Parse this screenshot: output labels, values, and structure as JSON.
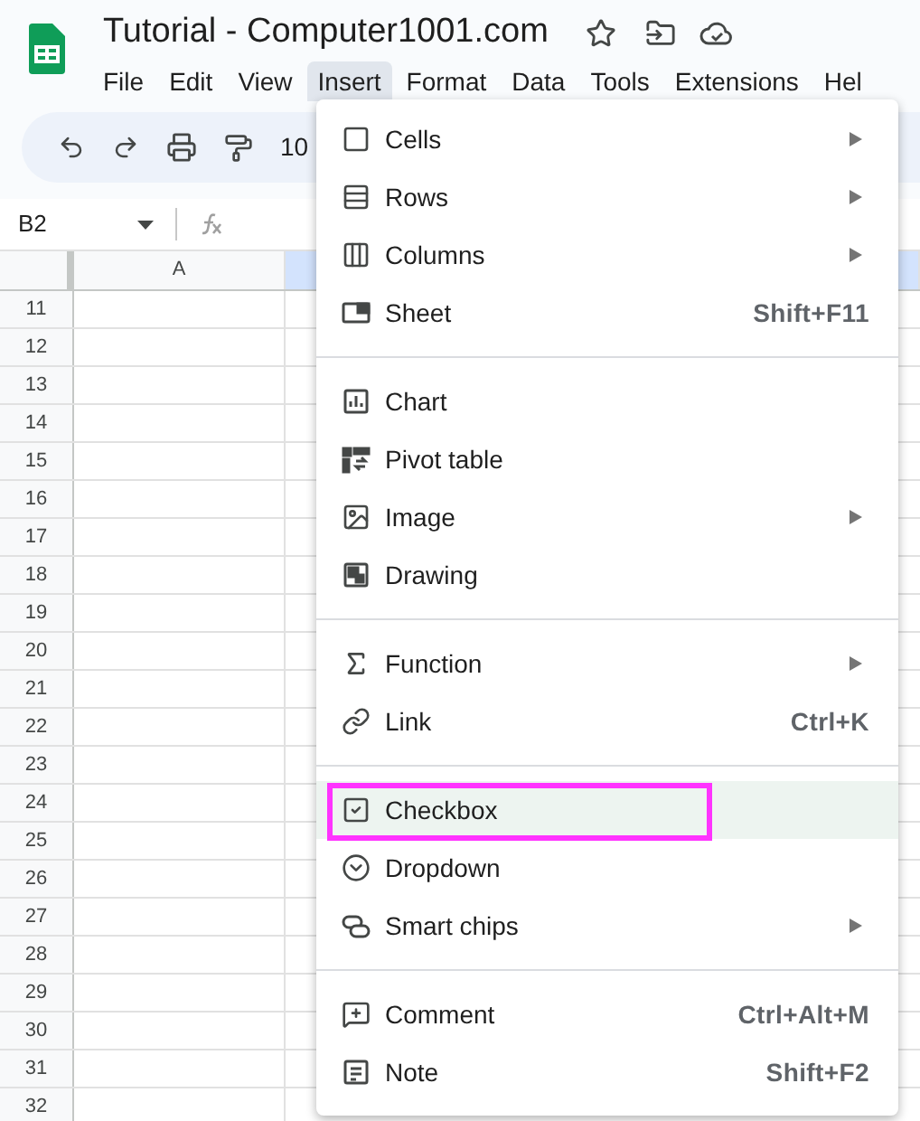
{
  "app": {
    "title": "Tutorial - Computer1001.com"
  },
  "menu_bar": [
    {
      "label": "File",
      "selected": false
    },
    {
      "label": "Edit",
      "selected": false
    },
    {
      "label": "View",
      "selected": false
    },
    {
      "label": "Insert",
      "selected": true
    },
    {
      "label": "Format",
      "selected": false
    },
    {
      "label": "Data",
      "selected": false
    },
    {
      "label": "Tools",
      "selected": false
    },
    {
      "label": "Extensions",
      "selected": false
    },
    {
      "label": "Hel",
      "selected": false
    }
  ],
  "toolbar": {
    "zoom": "10"
  },
  "formula_bar": {
    "cell_reference": "B2"
  },
  "grid": {
    "columns": [
      {
        "label": "A",
        "selected": false
      },
      {
        "selected": true
      }
    ],
    "rows": [
      "11",
      "12",
      "13",
      "14",
      "15",
      "16",
      "17",
      "18",
      "19",
      "20",
      "21",
      "22",
      "23",
      "24",
      "25",
      "26",
      "27",
      "28",
      "29",
      "30",
      "31",
      "32"
    ]
  },
  "insert_menu": {
    "sections": [
      [
        {
          "label": "Cells",
          "submenu": true,
          "selected": false
        },
        {
          "label": "Rows",
          "submenu": true,
          "selected": false
        },
        {
          "label": "Columns",
          "submenu": true,
          "selected": false
        },
        {
          "label": "Sheet",
          "shortcut": "Shift+F11",
          "submenu": false,
          "selected": false
        }
      ],
      [
        {
          "label": "Chart",
          "submenu": false,
          "selected": false
        },
        {
          "label": "Pivot table",
          "submenu": false,
          "selected": false
        },
        {
          "label": "Image",
          "submenu": true,
          "selected": false
        },
        {
          "label": "Drawing",
          "submenu": false,
          "selected": false
        }
      ],
      [
        {
          "label": "Function",
          "submenu": true,
          "selected": false
        },
        {
          "label": "Link",
          "shortcut": "Ctrl+K",
          "submenu": false,
          "selected": false
        }
      ],
      [
        {
          "label": "Checkbox",
          "submenu": false,
          "selected": true
        },
        {
          "label": "Dropdown",
          "submenu": false,
          "selected": false
        },
        {
          "label": "Smart chips",
          "submenu": true,
          "selected": false
        }
      ],
      [
        {
          "label": "Comment",
          "shortcut": "Ctrl+Alt+M",
          "submenu": false,
          "selected": false
        },
        {
          "label": "Note",
          "shortcut": "Shift+F2",
          "submenu": false,
          "selected": false
        }
      ]
    ]
  }
}
